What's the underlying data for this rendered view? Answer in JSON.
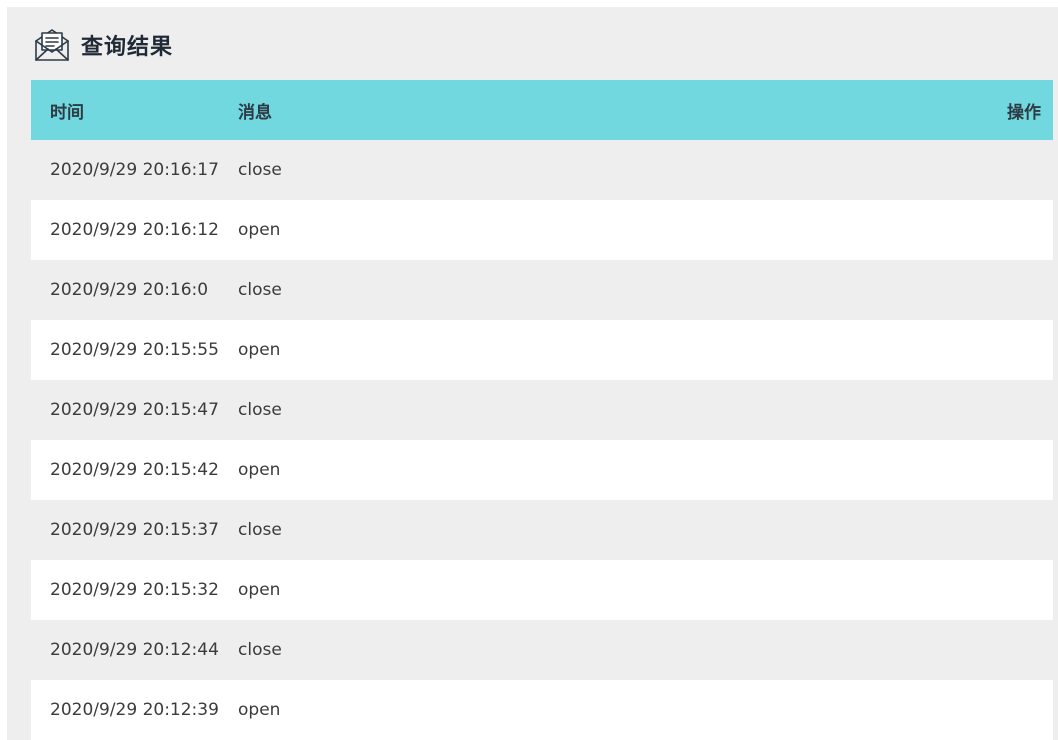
{
  "panel": {
    "title": "查询结果",
    "icon": "envelope-letter-icon"
  },
  "table": {
    "headers": {
      "time": "时间",
      "message": "消息",
      "action": "操作"
    },
    "rows": [
      {
        "time": "2020/9/29 20:16:17",
        "message": "close",
        "action": ""
      },
      {
        "time": "2020/9/29 20:16:12",
        "message": "open",
        "action": ""
      },
      {
        "time": "2020/9/29 20:16:0",
        "message": "close",
        "action": ""
      },
      {
        "time": "2020/9/29 20:15:55",
        "message": "open",
        "action": ""
      },
      {
        "time": "2020/9/29 20:15:47",
        "message": "close",
        "action": ""
      },
      {
        "time": "2020/9/29 20:15:42",
        "message": "open",
        "action": ""
      },
      {
        "time": "2020/9/29 20:15:37",
        "message": "close",
        "action": ""
      },
      {
        "time": "2020/9/29 20:15:32",
        "message": "open",
        "action": ""
      },
      {
        "time": "2020/9/29 20:12:44",
        "message": "close",
        "action": ""
      },
      {
        "time": "2020/9/29 20:12:39",
        "message": "open",
        "action": ""
      }
    ]
  },
  "colors": {
    "header_bg": "#71d8df",
    "panel_bg": "#eeeeee",
    "row_alt_bg": "#eeeeee",
    "row_bg": "#ffffff",
    "title_color": "#1f2a36"
  }
}
